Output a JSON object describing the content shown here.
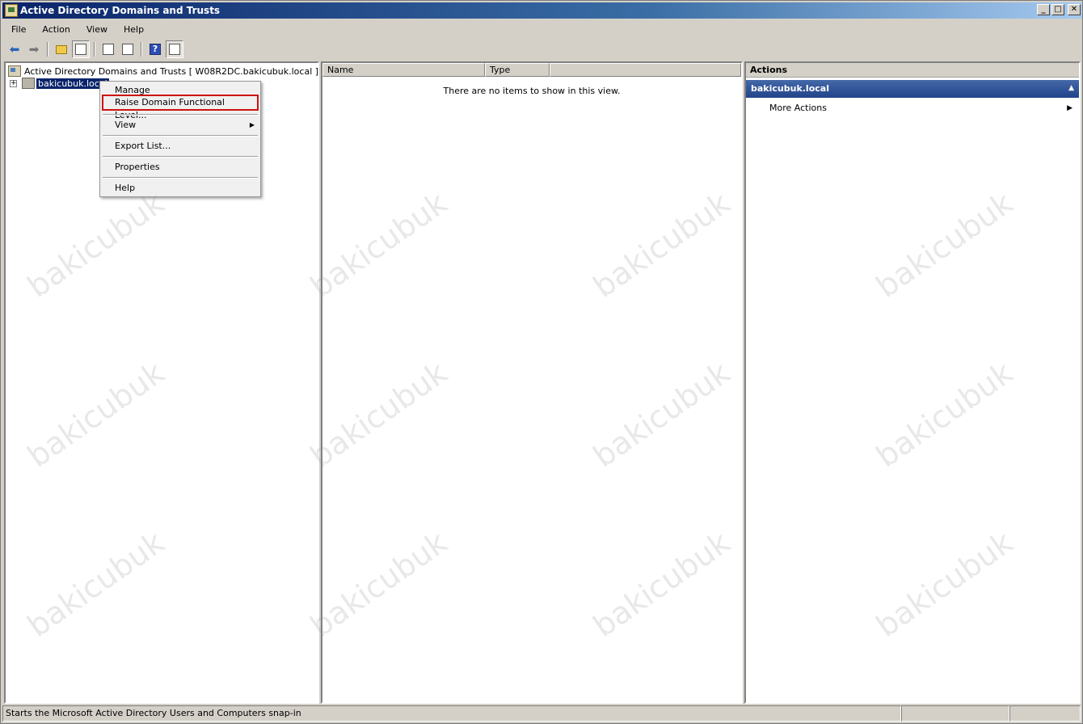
{
  "window": {
    "title": "Active Directory Domains and Trusts",
    "controls": {
      "minimize": "_",
      "maximize": "□",
      "close": "✕"
    }
  },
  "menu": [
    "File",
    "Action",
    "View",
    "Help"
  ],
  "toolbar": {
    "icons": [
      "back-arrow-icon",
      "forward-arrow-icon",
      "up-folder-icon",
      "show-hide-tree-icon",
      "properties-icon",
      "export-list-icon",
      "help-icon",
      "action-pane-icon"
    ]
  },
  "tree": {
    "root": "Active Directory Domains and Trusts [ W08R2DC.bakicubuk.local ]",
    "child": "bakicubuk.local"
  },
  "context_menu": {
    "items": [
      "Manage",
      "Raise Domain Functional Level...",
      "View",
      "Export List...",
      "Properties",
      "Help"
    ],
    "highlighted": "Raise Domain Functional Level..."
  },
  "list": {
    "columns": [
      "Name",
      "Type"
    ],
    "empty_message": "There are no items to show in this view."
  },
  "actions": {
    "header": "Actions",
    "section": "bakicubuk.local",
    "items": [
      "More Actions"
    ]
  },
  "status": {
    "text": "Starts the Microsoft Active Directory Users and Computers snap-in"
  },
  "watermark": "bakicubuk",
  "colors": {
    "title_bar": "#0a246a",
    "selection": "#0a246a",
    "highlight_border": "#d01010",
    "actions_section": "#22448a"
  }
}
